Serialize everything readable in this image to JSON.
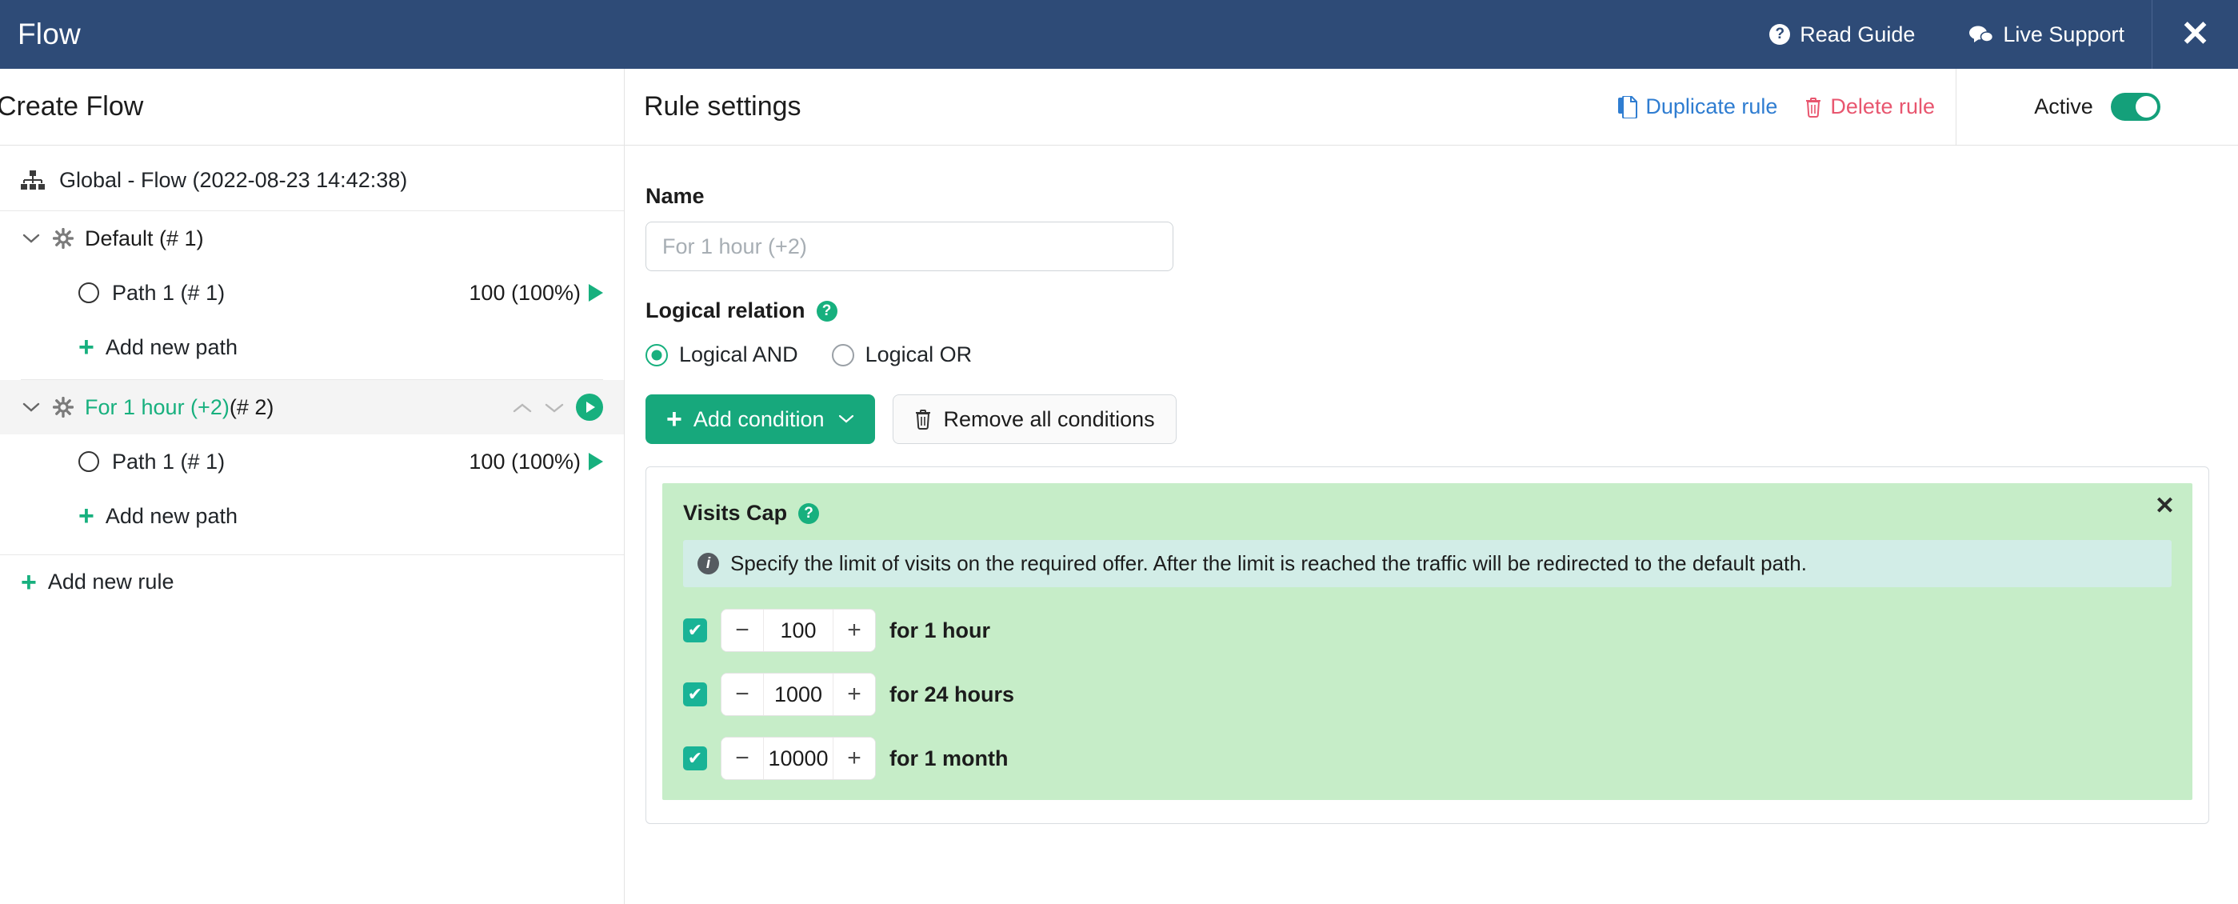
{
  "topbar": {
    "title": "Flow",
    "read_guide": "Read Guide",
    "live_support": "Live Support",
    "close_glyph": "✕",
    "help_glyph": "?",
    "chat_glyph": "💬"
  },
  "subbar": {
    "left_title": "Create Flow",
    "rule_settings_title": "Rule settings",
    "duplicate_rule": "Duplicate rule",
    "delete_rule": "Delete rule",
    "active_label": "Active",
    "duplicate_icon_glyph": "⧉",
    "delete_icon_glyph": "🗑"
  },
  "sidebar": {
    "root_label": "Global - Flow (2022-08-23 14:42:38)",
    "add_new_rule": "Add new rule",
    "rules": [
      {
        "name": "Default (# 1)",
        "selected": false,
        "chevron": "⌄",
        "paths": [
          {
            "label": "Path 1 (# 1)",
            "count": "100 (100%)"
          }
        ],
        "add_path_label": "Add new path"
      },
      {
        "name_green": "For 1 hour (+2)",
        "name_suffix": " (# 2)",
        "selected": true,
        "chevron": "⌄",
        "up_glyph": "⌃",
        "down_glyph": "⌄",
        "paths": [
          {
            "label": "Path 1 (# 1)",
            "count": "100 (100%)"
          }
        ],
        "add_path_label": "Add new path"
      }
    ]
  },
  "main": {
    "name_label": "Name",
    "name_value": "",
    "name_placeholder": "For 1 hour (+2)",
    "logical_relation_label": "Logical relation",
    "help_glyph": "?",
    "radio_and": "Logical AND",
    "radio_or": "Logical OR",
    "selected_relation": "and",
    "add_condition": "Add condition",
    "add_condition_caret": "⌄",
    "remove_all_conditions": "Remove all conditions",
    "plus_glyph": "+",
    "trash_glyph": "🗑",
    "condition": {
      "title": "Visits Cap",
      "help_glyph": "?",
      "close_glyph": "✕",
      "info_glyph": "i",
      "info_text": "Specify the limit of visits on the required offer. After the limit is reached the traffic will be redirected to the default path.",
      "caps": [
        {
          "checked": true,
          "check_glyph": "✔",
          "minus": "−",
          "value": "100",
          "plus": "+",
          "label": "for 1 hour"
        },
        {
          "checked": true,
          "check_glyph": "✔",
          "minus": "−",
          "value": "1000",
          "plus": "+",
          "label": "for 24 hours"
        },
        {
          "checked": true,
          "check_glyph": "✔",
          "minus": "−",
          "value": "10000",
          "plus": "+",
          "label": "for 1 month"
        }
      ]
    }
  },
  "colors": {
    "header_blue": "#2E4B77",
    "accent_green": "#17b07e",
    "button_green": "#17a87c",
    "panel_green": "#c6edc8",
    "info_teal": "#d2ede7",
    "link_blue": "#2f7dd1",
    "danger_red": "#e8566f"
  }
}
